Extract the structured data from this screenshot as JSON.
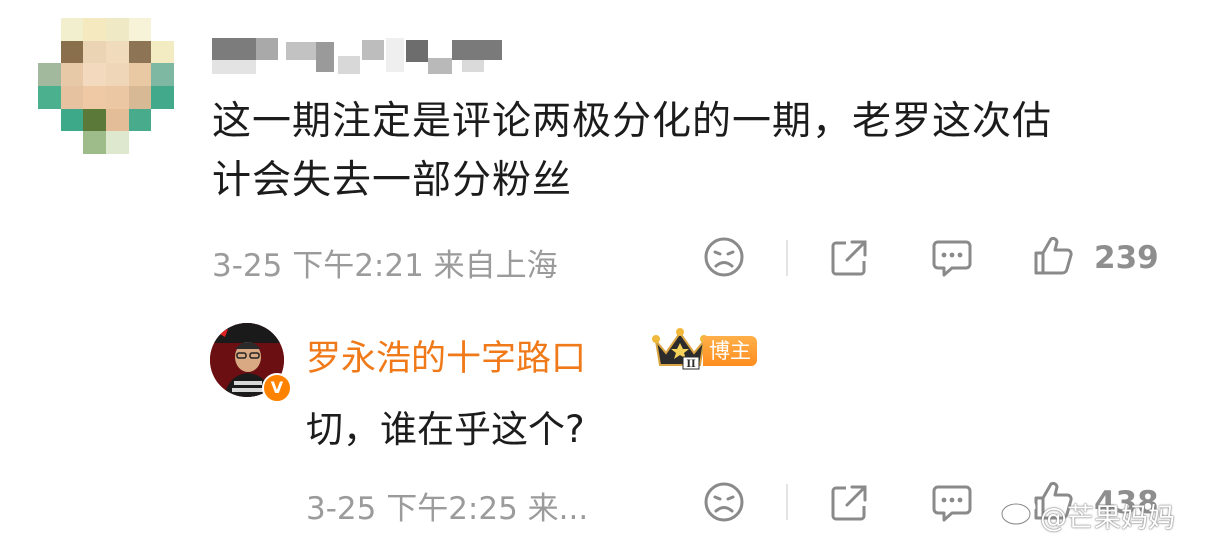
{
  "comment": {
    "text_line1": "这一期注定是评论两极分化的一期，老罗这次估",
    "text_line2": "计会失去一部分粉丝",
    "meta": "3-25 下午2:21 来自上海",
    "like_count": "239"
  },
  "reply": {
    "author": "罗永浩的十字路口",
    "badge": "博主",
    "crown_level": "II",
    "text": "切，谁在乎这个?",
    "meta": "3-25 下午2:25 来...",
    "like_count": "438"
  },
  "watermark": "@芒果妈妈",
  "colors": {
    "author_orange": "#f07a1a",
    "badge_orange": "#ff8d1e",
    "meta_gray": "#9b9b9b",
    "text": "#1c1c1c"
  },
  "icons": [
    "sad-face-icon",
    "share-icon",
    "comment-icon",
    "thumbs-up-icon",
    "crown-icon",
    "verified-v-icon",
    "weibo-logo-icon"
  ]
}
